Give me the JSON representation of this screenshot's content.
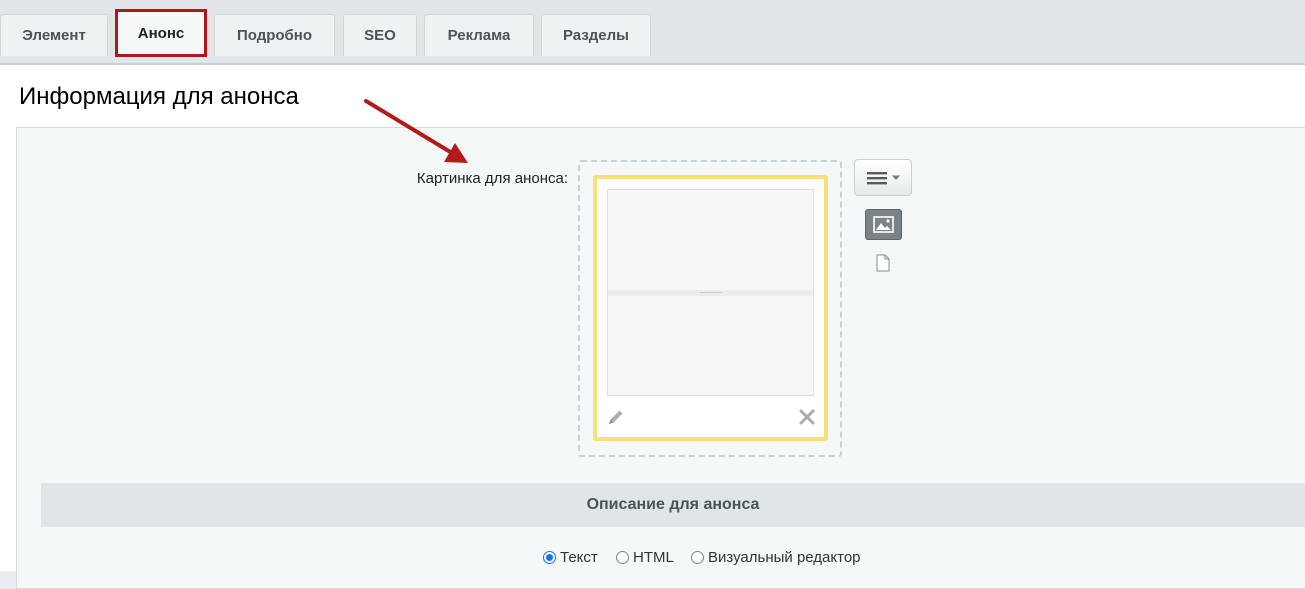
{
  "tabs": [
    {
      "label": "Элемент",
      "active": false
    },
    {
      "label": "Анонс",
      "active": true
    },
    {
      "label": "Подробно",
      "active": false
    },
    {
      "label": "SEO",
      "active": false
    },
    {
      "label": "Реклама",
      "active": false
    },
    {
      "label": "Разделы",
      "active": false
    }
  ],
  "page": {
    "title": "Информация для анонса"
  },
  "picture": {
    "label": "Картинка для анонса:",
    "icons": [
      "pencil-icon",
      "close-icon",
      "menu-icon",
      "image-icon",
      "file-icon"
    ]
  },
  "description": {
    "section_title": "Описание для анонса",
    "modes": [
      {
        "label": "Текст",
        "selected": true
      },
      {
        "label": "HTML",
        "selected": false
      },
      {
        "label": "Визуальный редактор",
        "selected": false
      }
    ]
  },
  "colors": {
    "active_tab_border": "#b01818",
    "annotation_arrow": "#b31b1b",
    "card_border": "#f7e07a",
    "radio_accent": "#1a73e8"
  }
}
